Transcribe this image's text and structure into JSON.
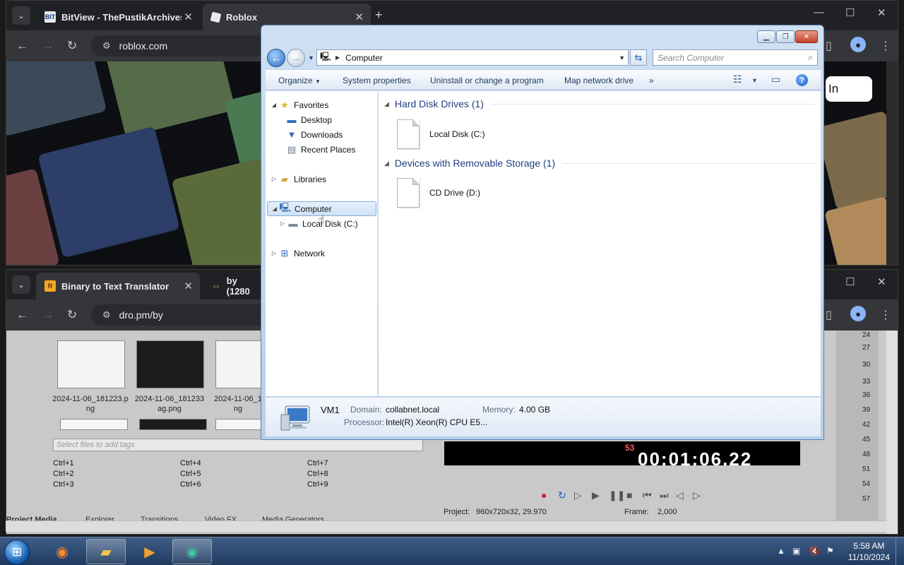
{
  "top_browser": {
    "tabs": [
      {
        "label": "BitView - ThePustikArchives's C",
        "favicon": "BIT",
        "active": false
      },
      {
        "label": "Roblox",
        "favicon": "",
        "active": true
      }
    ],
    "new_tab": "+",
    "url": "roblox.com",
    "page": {
      "signin_label": "In"
    }
  },
  "bottom_browser": {
    "tabs": [
      {
        "label": "Binary to Text Translator",
        "favicon": "R",
        "active": true
      },
      {
        "label": "by (1280",
        "favicon": "",
        "active": false
      }
    ],
    "url": "dro.pm/by",
    "vegas": {
      "thumb_labels": [
        "2024-11-06_181223.p\nng",
        "2024-11-06_181233\nag.png",
        "2024-11-06_1\nng"
      ],
      "tag_placeholder": "Select files to add tags",
      "hotkeys": [
        "Ctrl+1",
        "Ctrl+2",
        "Ctrl+3",
        "Ctrl+4",
        "Ctrl+5",
        "Ctrl+6",
        "Ctrl+7",
        "Ctrl+8",
        "Ctrl+9"
      ],
      "rec_count": "53",
      "timecode": "00:01:06.22",
      "project_label": "Project:",
      "project_value": "960x720x32, 29.970",
      "frame_label": "Frame:",
      "frame_value": "2,000",
      "bottom_tabs": [
        "Project Media",
        "Explorer",
        "Transitions",
        "Video FX",
        "Media Generators"
      ],
      "meter_ticks": [
        "24",
        "27",
        "30",
        "33",
        "36",
        "39",
        "42",
        "45",
        "48",
        "51",
        "54",
        "57"
      ]
    }
  },
  "explorer": {
    "address": "Computer",
    "search_placeholder": "Search Computer",
    "commands": [
      "Organize",
      "System properties",
      "Uninstall or change a program",
      "Map network drive",
      "»"
    ],
    "nav": {
      "favorites": "Favorites",
      "desktop": "Desktop",
      "downloads": "Downloads",
      "recent": "Recent Places",
      "libraries": "Libraries",
      "computer": "Computer",
      "local_disk": "Local Disk (C:)",
      "network": "Network"
    },
    "groups": {
      "hdd_header": "Hard Disk Drives (1)",
      "hdd_item": "Local Disk (C:)",
      "removable_header": "Devices with Removable Storage (1)",
      "removable_item": "CD Drive (D:)"
    },
    "details": {
      "name": "VM1",
      "domain_label": "Domain:",
      "domain_value": "collabnet.local",
      "memory_label": "Memory:",
      "memory_value": "4.00 GB",
      "processor_label": "Processor:",
      "processor_value": "Intel(R) Xeon(R) CPU E5..."
    }
  },
  "taskbar": {
    "time": "5:58 AM",
    "date": "11/10/2024"
  },
  "colors": {
    "chrome_bg": "#202124",
    "chrome_toolbar": "#35363a",
    "explorer_frame": "#b9cfe8",
    "explorer_link": "#1e3f80",
    "taskbar": "#1f3a5f"
  }
}
